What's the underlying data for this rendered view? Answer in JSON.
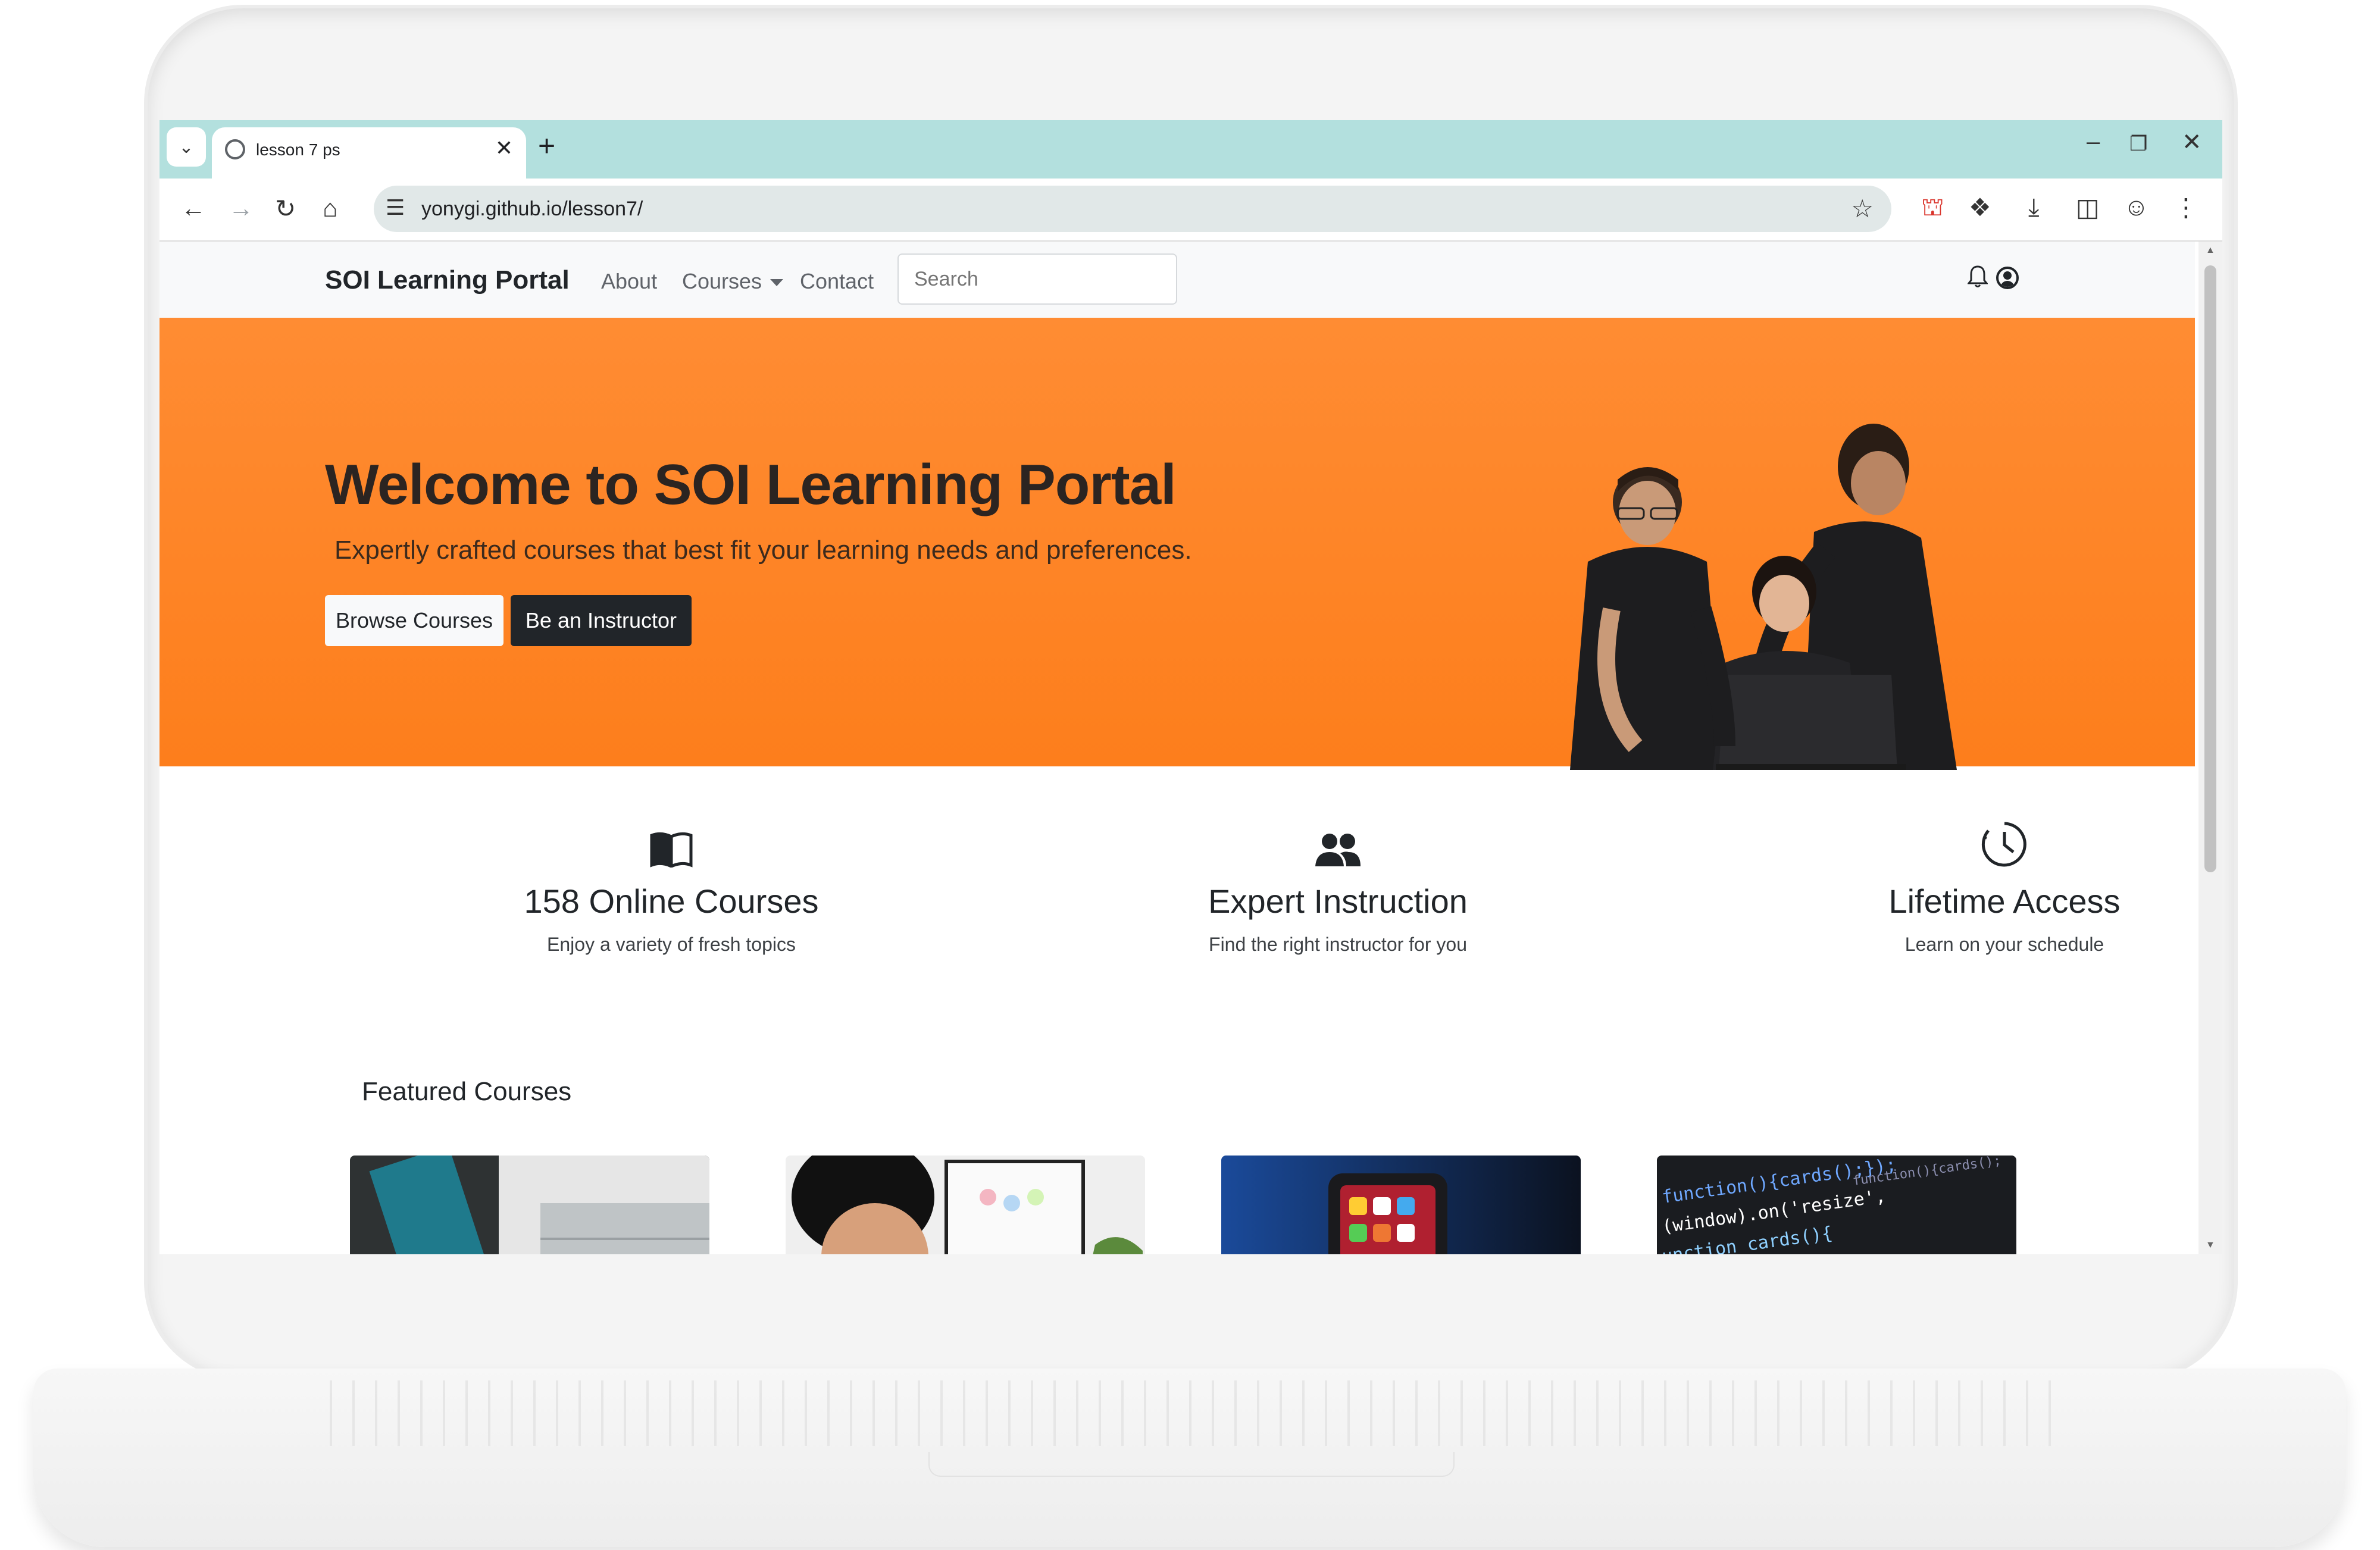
{
  "browser": {
    "tab_title": "lesson 7 ps",
    "url": "yonygi.github.io/lesson7/"
  },
  "navbar": {
    "brand": "SOI Learning Portal",
    "links": [
      "About",
      "Courses",
      "Contact"
    ],
    "search_placeholder": "Search"
  },
  "hero": {
    "title": "Welcome to SOI Learning Portal",
    "subtitle": "Expertly crafted courses that best fit your learning needs and preferences.",
    "primary_button": "Browse Courses",
    "secondary_button": "Be an Instructor",
    "background_color": "#fd7e1c"
  },
  "features": [
    {
      "icon": "book-icon",
      "title": "158 Online Courses",
      "text": "Enjoy a variety of fresh topics"
    },
    {
      "icon": "people-icon",
      "title": "Expert Instruction",
      "text": "Find the right instructor for you"
    },
    {
      "icon": "clock-icon",
      "title": "Lifetime Access",
      "text": "Learn on your schedule"
    }
  ],
  "featured": {
    "heading": "Featured Courses"
  },
  "colors": {
    "tab_strip": "#b3e0de",
    "dark_button": "#212529"
  }
}
